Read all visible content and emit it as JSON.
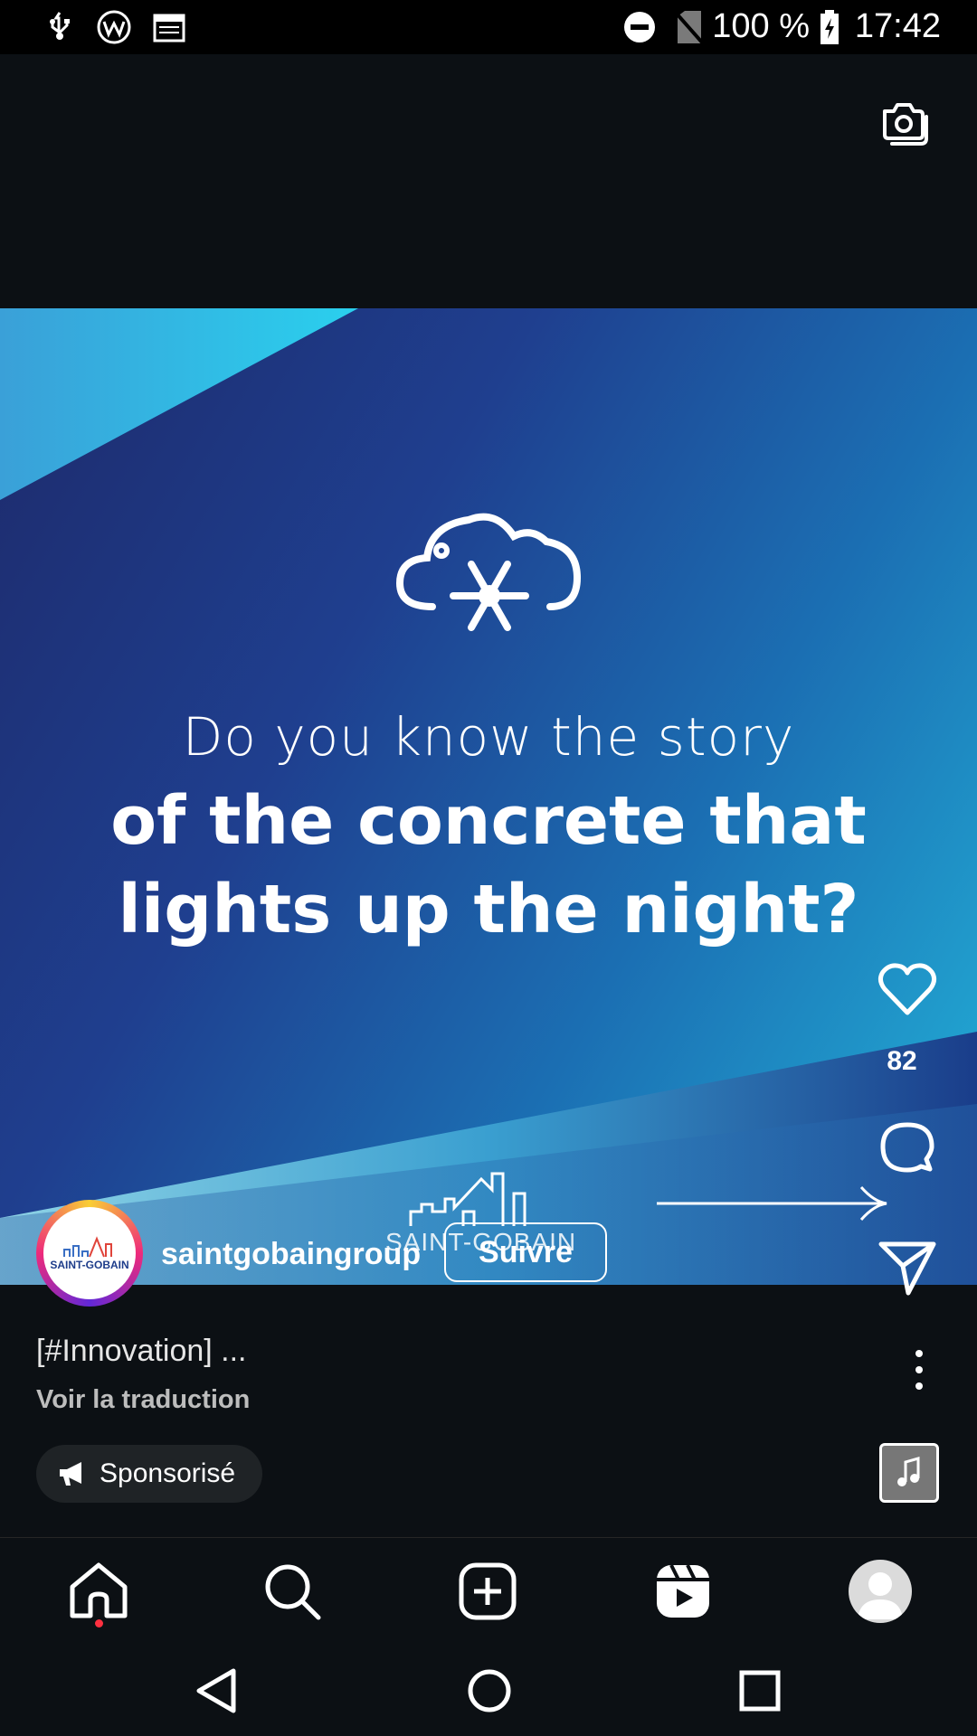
{
  "status_bar": {
    "battery": "100 %",
    "time": "17:42"
  },
  "reel": {
    "headline_line1": "Do you know the story",
    "headline_line2": "of the concrete that lights up the night?",
    "watermark": "SAINT-GOBAIN",
    "like_count": "82"
  },
  "author": {
    "avatar_text": "SAINT-GOBAIN",
    "username": "saintgobaingroup",
    "follow_label": "Suivre"
  },
  "caption": {
    "text": "[#Innovation] ...",
    "translate_label": "Voir la traduction",
    "sponsored_label": "Sponsorisé"
  },
  "icons": {
    "status": [
      "usb-icon",
      "w-app-icon",
      "calendar-icon",
      "dnd-icon",
      "no-sim-icon",
      "battery-charging-icon"
    ],
    "rail": [
      "heart-icon",
      "comment-icon",
      "share-icon",
      "more-icon"
    ],
    "nav": [
      "home-icon",
      "search-icon",
      "create-icon",
      "reels-icon",
      "profile-icon"
    ],
    "system": [
      "back-icon",
      "home-circle-icon",
      "recents-icon"
    ]
  },
  "colors": {
    "background": "#0c1014",
    "accent_dot": "#ff3040"
  }
}
